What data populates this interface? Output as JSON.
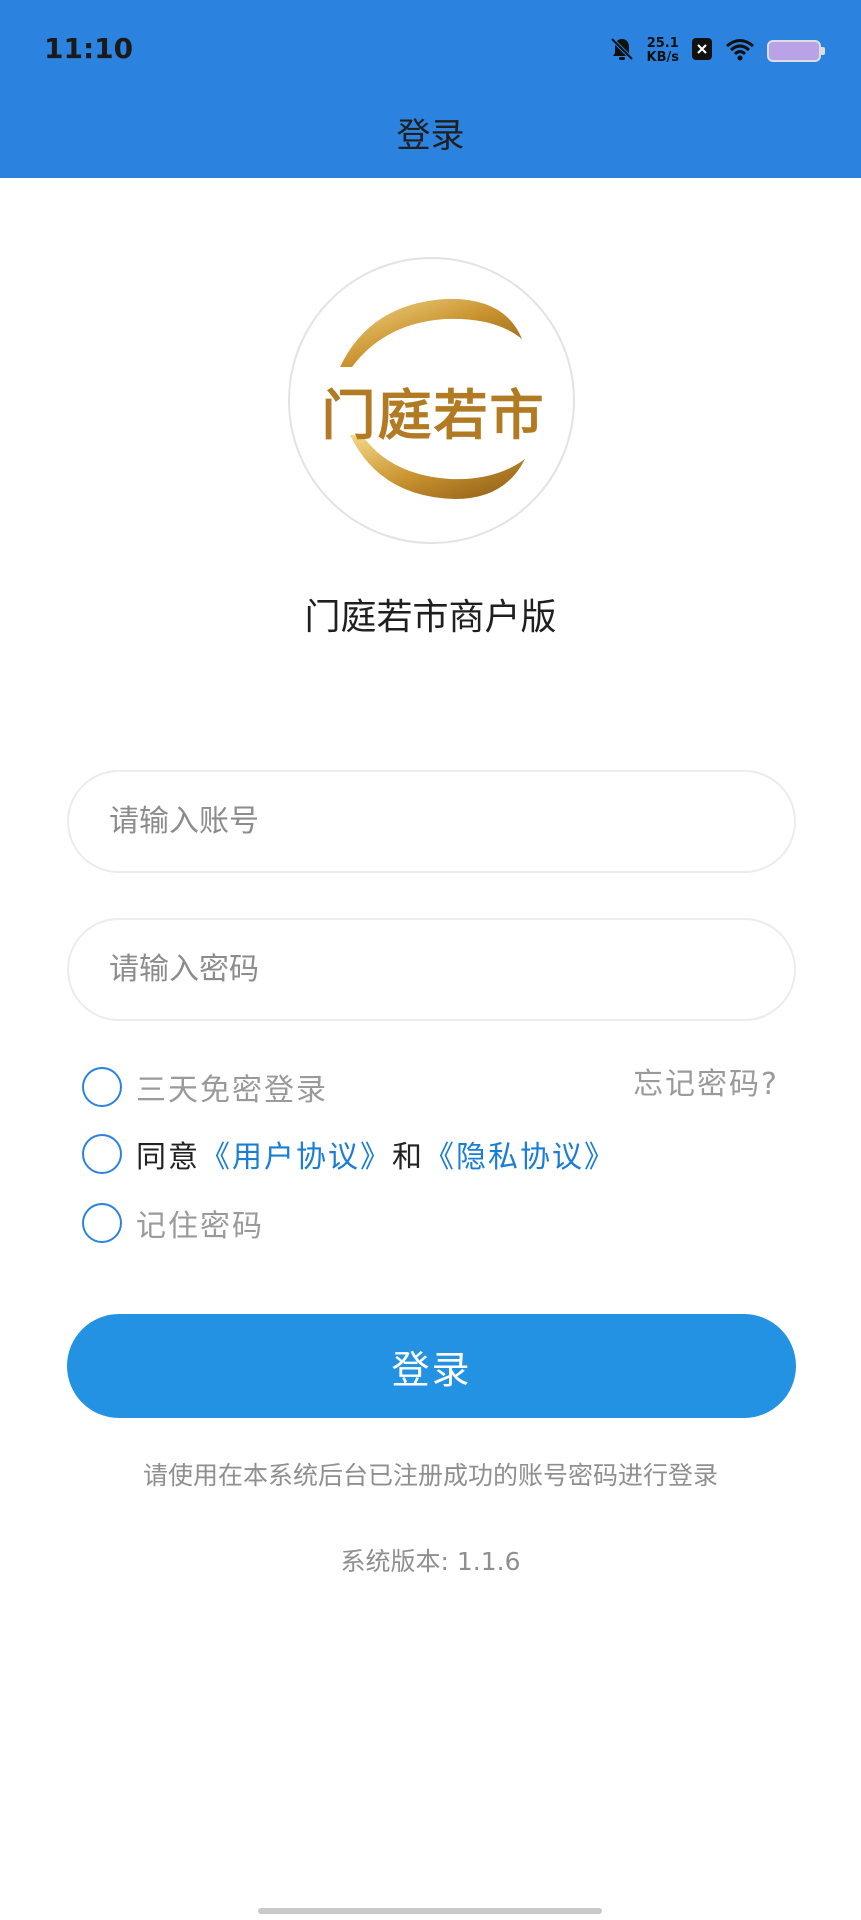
{
  "status_bar": {
    "time": "11:10",
    "net_speed_value": "25.1",
    "net_speed_unit": "KB/s",
    "icons": [
      "bell-mute-icon",
      "close-box-icon",
      "wifi-icon",
      "battery-icon"
    ]
  },
  "header": {
    "title": "登录",
    "bg_color": "#2b83df"
  },
  "logo": {
    "text": "门庭若市",
    "colors": {
      "gold_light": "#f2cf7c",
      "gold_dark": "#a3701f"
    }
  },
  "app_name": "门庭若市商户版",
  "form": {
    "account_placeholder": "请输入账号",
    "password_placeholder": "请输入密码"
  },
  "options": {
    "remember_three_days": "三天免密登录",
    "forgot_password": "忘记密码?",
    "agree_prefix": "同意",
    "user_agreement": "《用户协议》",
    "agree_and": "和",
    "privacy_agreement": "《隐私协议》",
    "remember_password": "记住密码"
  },
  "login_button": {
    "label": "登录",
    "color": "#2492e3"
  },
  "hint": "请使用在本系统后台已注册成功的账号密码进行登录",
  "version": {
    "label": "系统版本:",
    "value": "1.1.6"
  }
}
